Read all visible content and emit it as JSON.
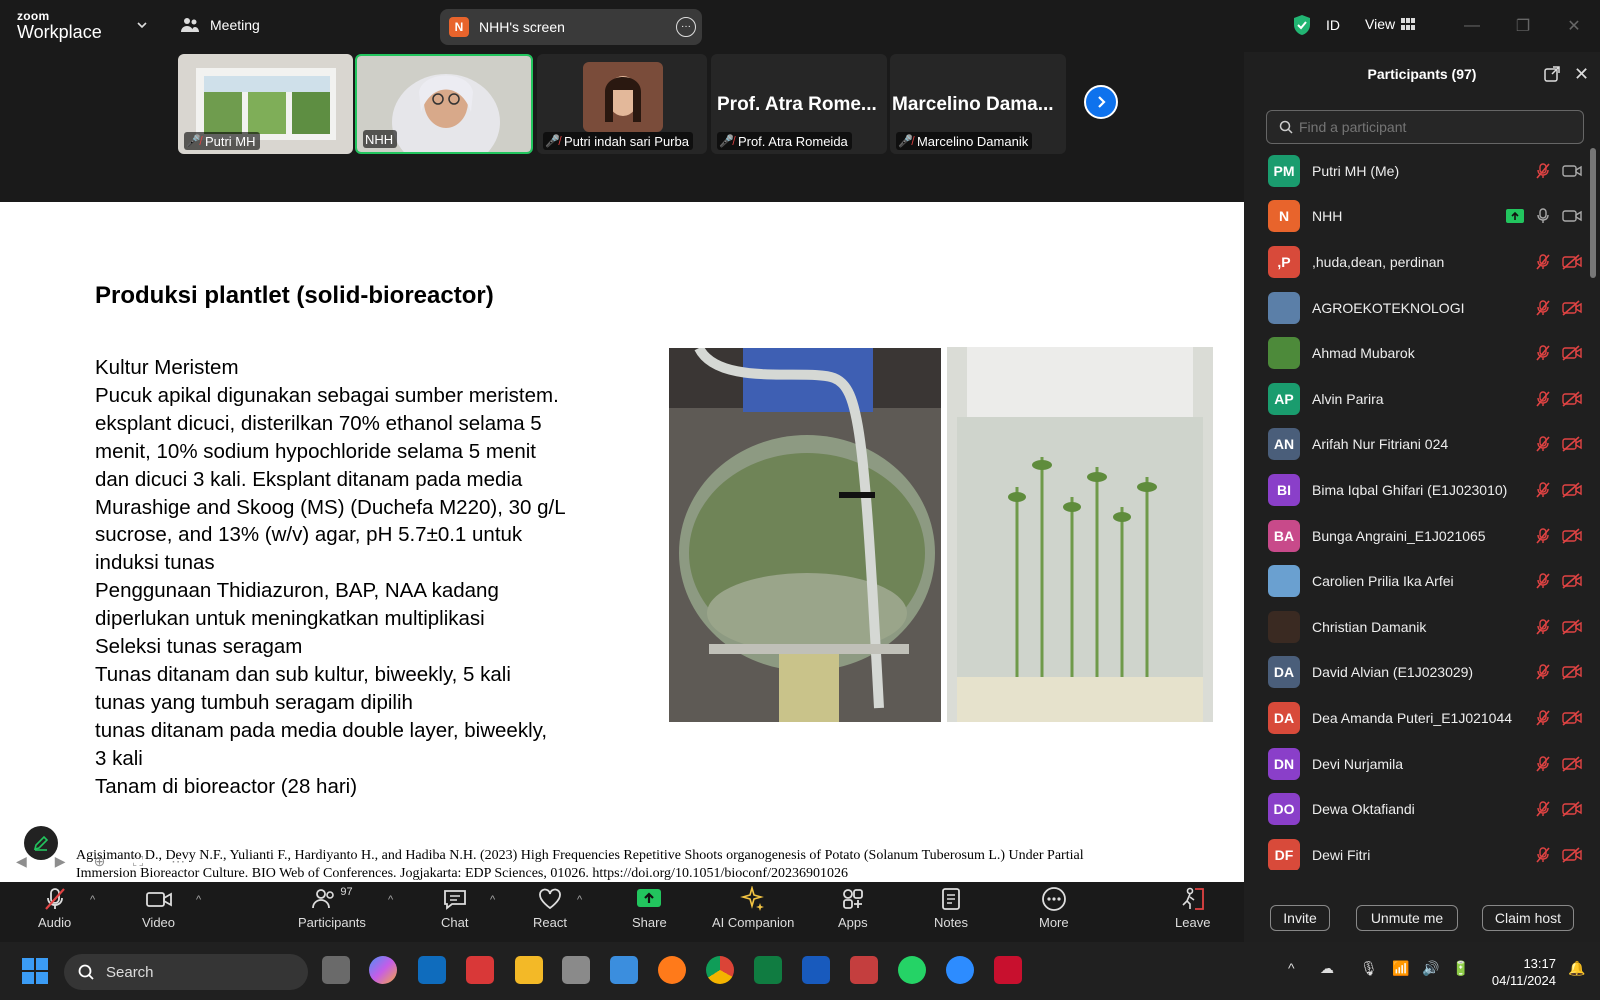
{
  "app": {
    "brand_small": "zoom",
    "brand_name": "Workplace"
  },
  "topbar": {
    "meeting_label": "Meeting",
    "screen_badge": "N",
    "screen_label": "NHH's screen",
    "id_label": "ID",
    "view_label": "View"
  },
  "strip": {
    "tiles": [
      {
        "name": "Putri MH"
      },
      {
        "name": "NHH"
      },
      {
        "name": "Putri indah sari Purba"
      },
      {
        "big": "Prof. Atra Rome...",
        "name": "Prof. Atra Romeida"
      },
      {
        "big": "Marcelino Dama...",
        "name": "Marcelino Damanik"
      }
    ]
  },
  "slide": {
    "title": "Produksi plantlet (solid-bioreactor)",
    "lines": [
      "Kultur Meristem",
      "Pucuk apikal digunakan sebagai sumber meristem.",
      "eksplant dicuci, disterilkan 70% ethanol selama 5",
      "menit, 10% sodium hypochloride selama 5 menit",
      "dan dicuci 3 kali. Eksplant ditanam pada media",
      "Murashige and Skoog (MS) (Duchefa M220), 30 g/L",
      "sucrose, and 13% (w/v) agar, pH 5.7±0.1 untuk",
      "induksi tunas",
      "Penggunaan Thidiazuron, BAP, NAA kadang",
      "diperlukan untuk meningkatkan multiplikasi",
      "Seleksi tunas seragam",
      "Tunas ditanam dan sub kultur, biweekly, 5 kali",
      "tunas yang tumbuh seragam dipilih",
      "tunas ditanam pada media double layer, biweekly,",
      "3 kali",
      "Tanam di bioreactor (28 hari)"
    ],
    "citation_1": "Agisimanto D., Devy N.F., Yulianti F., Hardiyanto H., and Hadiba N.H. (2023) High Frequencies Repetitive Shoots organogenesis of Potato (Solanum Tuberosum L.) Under Partial",
    "citation_2": "Immersion Bioreactor Culture. BIO Web of Conferences. Jogjakarta: EDP Sciences, 01026. https://doi.org/10.1051/bioconf/20236901026"
  },
  "participants": {
    "title": "Participants (97)",
    "search_placeholder": "Find a participant",
    "list": [
      {
        "initials": "PM",
        "name": "Putri MH (Me)",
        "color": "#1a9c6e"
      },
      {
        "initials": "N",
        "name": "NHH",
        "color": "#e8642c"
      },
      {
        "initials": ",P",
        "name": ",huda,dean, perdinan",
        "color": "#d84a3a"
      },
      {
        "initials": "",
        "name": "AGROEKOTEKNOLOGI",
        "color": "#5b7fa8"
      },
      {
        "initials": "",
        "name": "Ahmad Mubarok",
        "color": "#4d8a3a"
      },
      {
        "initials": "AP",
        "name": "Alvin Parira",
        "color": "#1a9c6e"
      },
      {
        "initials": "AN",
        "name": "Arifah Nur Fitriani 024",
        "color": "#4a5e7a"
      },
      {
        "initials": "BI",
        "name": "Bima Iqbal Ghifari (E1J023010)",
        "color": "#8a3fc9"
      },
      {
        "initials": "BA",
        "name": "Bunga Angraini_E1J021065",
        "color": "#c84a8a"
      },
      {
        "initials": "",
        "name": "Carolien Prilia Ika Arfei",
        "color": "#6aa0d0"
      },
      {
        "initials": "",
        "name": "Christian Damanik",
        "color": "#3a2a22"
      },
      {
        "initials": "DA",
        "name": "David Alvian (E1J023029)",
        "color": "#4a5e7a"
      },
      {
        "initials": "DA",
        "name": "Dea Amanda Puteri_E1J021044",
        "color": "#d84a3a"
      },
      {
        "initials": "DN",
        "name": "Devi Nurjamila",
        "color": "#8a3fc9"
      },
      {
        "initials": "DO",
        "name": "Dewa Oktafiandi",
        "color": "#8a3fc9"
      },
      {
        "initials": "DF",
        "name": "Dewi Fitri",
        "color": "#d84a3a"
      }
    ],
    "invite": "Invite",
    "unmute": "Unmute me",
    "claim": "Claim host"
  },
  "toolbar": {
    "audio": "Audio",
    "video": "Video",
    "participants": "Participants",
    "participants_count": "97",
    "chat": "Chat",
    "react": "React",
    "share": "Share",
    "ai": "AI Companion",
    "apps": "Apps",
    "notes": "Notes",
    "more": "More",
    "leave": "Leave"
  },
  "taskbar": {
    "search": "Search",
    "time": "13:17",
    "date": "04/11/2024"
  }
}
